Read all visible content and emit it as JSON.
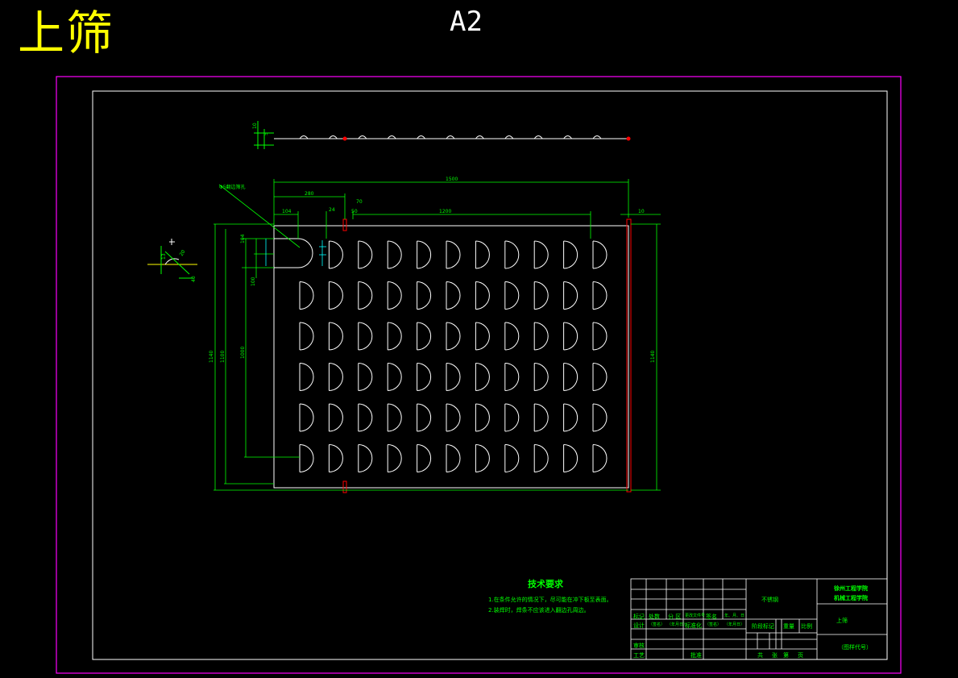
{
  "header": {
    "part_name": "上筛",
    "sheet_size": "A2"
  },
  "colors": {
    "background": "#000000",
    "frame": "#ff00ff",
    "outline": "#ffffff",
    "dimension": "#00ff00",
    "title_text": "#ffff00",
    "accent": "#00ffff",
    "marker": "#ff0000"
  },
  "dimensions": {
    "overall_length": "1500",
    "left_offset": "280",
    "hole_pitch_span": "1200",
    "first_hole": "104",
    "left_gap": "24",
    "right_gap": "50",
    "edge_tab": "70",
    "right_tab": "10",
    "height_outer": "1140",
    "height_inner": "1100",
    "height_holes": "1000",
    "hole_height": "104",
    "hole_offset": "100",
    "detail_a": "10",
    "detail_b": "5",
    "detail_c": "20",
    "detail_d": "13",
    "detail_e": "40",
    "callout": "Φ5翻边筛孔"
  },
  "hole_grid": {
    "rows": 6,
    "cols": 11
  },
  "tech_requirements": {
    "title": "技术要求",
    "lines": [
      "1.在条件允许的情况下，尽可能在冲下板至表面。",
      "2.装焊时，焊条不应该进入翻边孔周边。"
    ]
  },
  "title_block": {
    "material": "不锈钢",
    "school_line1": "徐州工程学院",
    "school_line2": "机械工程学院",
    "drawing_name": "上筛",
    "drawing_code": "（图样代号）",
    "labels": {
      "mark": "标记",
      "count": "处数",
      "zone": "分 区",
      "change_doc": "更改文件号",
      "sign": "签名",
      "date": "年、月、日",
      "design": "设计",
      "signature": "（签名）",
      "date2": "（年月日）",
      "standard": "标准化",
      "signature2": "（签名）",
      "date3": "（年月日）",
      "stage_mark": "阶段标记",
      "weight": "重量",
      "scale": "比例",
      "review": "审核",
      "process": "工艺",
      "approve": "批准",
      "total": "共",
      "sheet": "张",
      "page": "第",
      "page_unit": "页"
    }
  }
}
